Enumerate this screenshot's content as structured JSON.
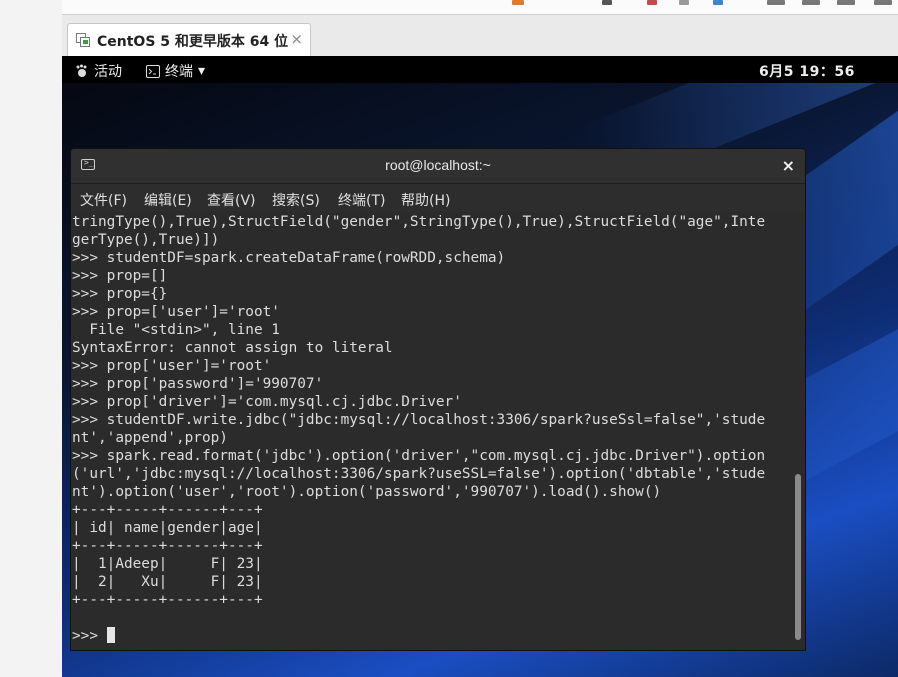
{
  "host": {
    "tab_label": "CentOS 5 和更早版本 64 位",
    "tab_close": "×"
  },
  "topbar": {
    "activities_label": "活动",
    "app_menu_label": "终端",
    "app_menu_arrow": "▾",
    "clock": "6月5 19：56"
  },
  "terminal": {
    "title": "root@localhost:~",
    "close_glyph": "×",
    "menu": [
      "文件(F)",
      "编辑(E)",
      "查看(V)",
      "搜索(S)",
      "终端(T)",
      "帮助(H)"
    ],
    "lines": [
      "tringType(),True),StructField(\"gender\",StringType(),True),StructField(\"age\",Inte",
      "gerType(),True)])",
      ">>> studentDF=spark.createDataFrame(rowRDD,schema)",
      ">>> prop=[]",
      ">>> prop={}",
      ">>> prop=['user']='root'",
      "  File \"<stdin>\", line 1",
      "SyntaxError: cannot assign to literal",
      ">>> prop['user']='root'",
      ">>> prop['password']='990707'",
      ">>> prop['driver']='com.mysql.cj.jdbc.Driver'",
      ">>> studentDF.write.jdbc(\"jdbc:mysql://localhost:3306/spark?useSsl=false\",'stude",
      "nt','append',prop)",
      ">>> spark.read.format('jdbc').option('driver',\"com.mysql.cj.jdbc.Driver\").option",
      "('url','jdbc:mysql://localhost:3306/spark?useSSL=false').option('dbtable','stude",
      "nt').option('user','root').option('password','990707').load().show()",
      "+---+-----+------+---+",
      "| id| name|gender|age|",
      "+---+-----+------+---+",
      "|  1|Adeep|     F| 23|",
      "|  2|   Xu|     F| 23|",
      "+---+-----+------+---+",
      ""
    ],
    "prompt": ">>> "
  },
  "colors": {
    "terminal_bg": "#2b2b2b",
    "terminal_fg": "#dcdcdc",
    "gnome_bar": "#000000",
    "desktop_blue": "#1b4ec2"
  }
}
